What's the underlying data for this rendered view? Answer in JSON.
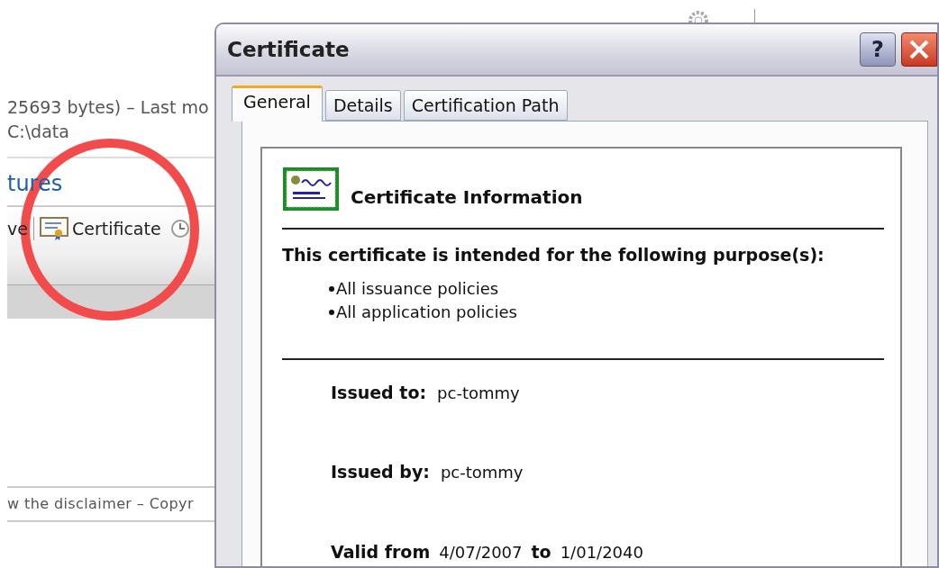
{
  "background_page": {
    "file_info": "25693 bytes) – Last mo",
    "path": "C:\\data",
    "heading": "tures",
    "toolbar": [
      {
        "kind": "text",
        "label": "ve",
        "highlighted": false
      },
      {
        "kind": "certificate",
        "label": "Certificate",
        "highlighted": true
      }
    ],
    "footer": "w the disclaimer – Copyr"
  },
  "dialog": {
    "title": "Certificate",
    "help_button": "?",
    "tabs": [
      {
        "label": "General",
        "selected": true
      },
      {
        "label": "Details",
        "selected": false
      },
      {
        "label": "Certification Path",
        "selected": false
      }
    ],
    "info_title": "Certificate Information",
    "purpose_heading": "This certificate is intended for the following purpose(s):",
    "purposes": [
      "All issuance policies",
      "All application policies"
    ],
    "fields": [
      {
        "label": "Issued to:",
        "value": "pc-tommy"
      },
      {
        "label": "Issued by:",
        "value": "pc-tommy"
      }
    ],
    "validity": {
      "from_label": "Valid from",
      "from": "4/07/2007",
      "to_label": "to",
      "to": "1/01/2040"
    }
  }
}
